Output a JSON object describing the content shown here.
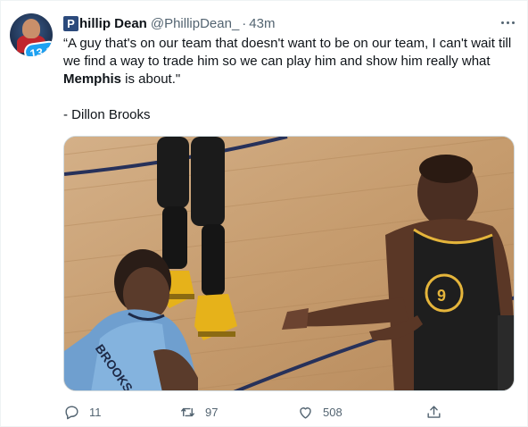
{
  "tweet": {
    "author_initial": "P",
    "author_name_rest": "hillip Dean",
    "handle": "@PhillipDean_",
    "separator": "·",
    "time": "43m",
    "avatar_badge": "13.1",
    "text": {
      "line1": "“A guy that's on our team that doesn't want to be on our team, I can't wait till",
      "line2": "we find a way to trade him so we can play him and show him really what",
      "line3_bold": "Memphis",
      "line3_rest": " is about.\"",
      "attribution": "- Dillon Brooks"
    },
    "media": {
      "jersey_left_text": "BROOKS",
      "jersey_right_number": "9"
    },
    "actions": {
      "replies": "11",
      "retweets": "97",
      "likes": "508"
    }
  },
  "colors": {
    "text_primary": "#0f1419",
    "text_secondary": "#536471",
    "accent": "#1da1f2"
  },
  "icons": [
    "more-icon",
    "reply-icon",
    "retweet-icon",
    "like-icon",
    "share-icon"
  ]
}
